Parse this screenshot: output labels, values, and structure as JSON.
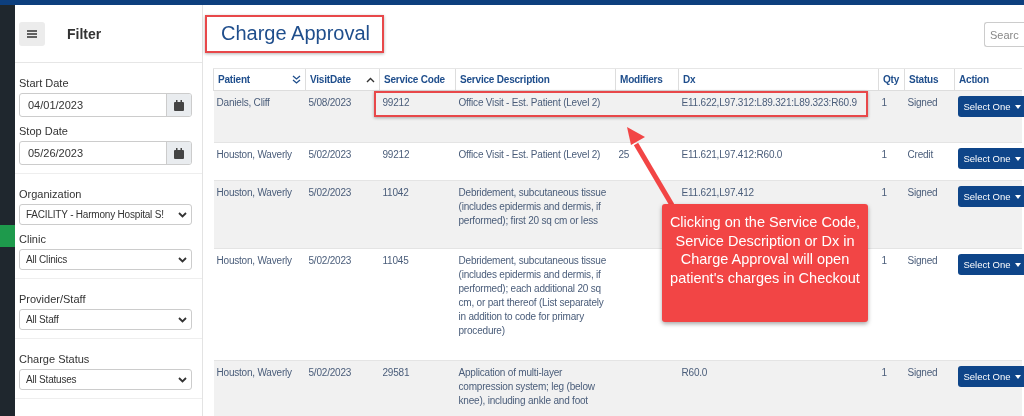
{
  "sidebar": {
    "title": "Filter",
    "fields": [
      {
        "kind": "date",
        "label": "Start Date",
        "value": "04/01/2023"
      },
      {
        "kind": "date",
        "label": "Stop Date",
        "value": "05/26/2023"
      },
      {
        "kind": "select",
        "label": "Organization",
        "value": "FACILITY - Harmony Hospital S!"
      },
      {
        "kind": "select",
        "label": "Clinic",
        "value": "All Clinics"
      },
      {
        "kind": "select",
        "label": "Provider/Staff",
        "value": "All Staff"
      },
      {
        "kind": "select",
        "label": "Charge Status",
        "value": "All Statuses"
      }
    ]
  },
  "page_title": "Charge Approval",
  "search": {
    "placeholder": "Searc"
  },
  "table": {
    "columns": [
      {
        "label": "Patient"
      },
      {
        "label": "VisitDate"
      },
      {
        "label": "Service Code"
      },
      {
        "label": "Service Description"
      },
      {
        "label": "Modifiers"
      },
      {
        "label": "Dx"
      },
      {
        "label": "Qty"
      },
      {
        "label": "Status"
      },
      {
        "label": "Action"
      }
    ],
    "rows": [
      {
        "patient": "Daniels, Cliff",
        "visit_date": "5/08/2023",
        "service_code": "99212",
        "service_description": "Office Visit - Est. Patient (Level 2)",
        "modifiers": "",
        "dx": "E11.622,L97.312:L89.321:L89.323:R60.9",
        "qty": "1",
        "status": "Signed",
        "action": "Select One"
      },
      {
        "patient": "Houston, Waverly",
        "visit_date": "5/02/2023",
        "service_code": "99212",
        "service_description": "Office Visit - Est. Patient (Level 2)",
        "modifiers": "25",
        "dx": "E11.621,L97.412:R60.0",
        "qty": "1",
        "status": "Credit",
        "action": "Select One"
      },
      {
        "patient": "Houston, Waverly",
        "visit_date": "5/02/2023",
        "service_code": "11042",
        "service_description": "Debridement, subcutaneous tissue (includes epidermis and dermis, if performed); first 20 sq cm or less",
        "modifiers": "",
        "dx": "E11.621,L97.412",
        "qty": "1",
        "status": "Signed",
        "action": "Select One"
      },
      {
        "patient": "Houston, Waverly",
        "visit_date": "5/02/2023",
        "service_code": "11045",
        "service_description": "Debridement, subcutaneous tissue (includes epidermis and dermis, if performed); each additional 20 sq cm, or part thereof (List separately in addition to code for primary procedure)",
        "modifiers": "",
        "dx": "",
        "qty": "1",
        "status": "Signed",
        "action": "Select One"
      },
      {
        "patient": "Houston, Waverly",
        "visit_date": "5/02/2023",
        "service_code": "29581",
        "service_description": "Application of multi-layer compression system; leg (below knee), including ankle and foot",
        "modifiers": "",
        "dx": "R60.0",
        "qty": "1",
        "status": "Signed",
        "action": "Select One"
      }
    ]
  },
  "annotation": {
    "callout": "Clicking on the Service Code, Service Description or Dx in Charge Approval will open patient's charges in Checkout"
  }
}
